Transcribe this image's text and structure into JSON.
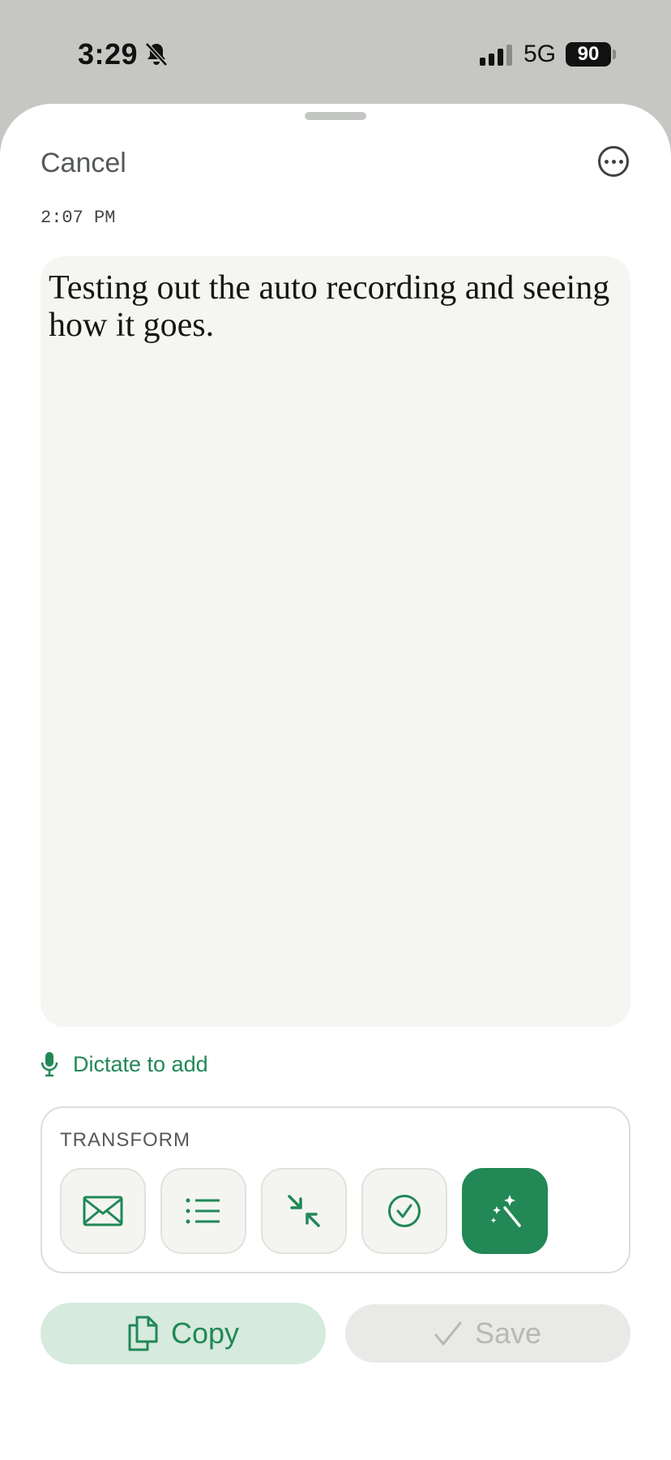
{
  "status_bar": {
    "time": "3:29",
    "network": "5G",
    "battery": "90"
  },
  "header": {
    "cancel_label": "Cancel",
    "more_icon": "ellipsis-circle-icon"
  },
  "note": {
    "timestamp": "2:07 PM",
    "text": "Testing out the auto recording and seeing how it goes."
  },
  "dictate": {
    "label": "Dictate to add",
    "icon": "microphone-icon"
  },
  "transform": {
    "title": "TRANSFORM",
    "tools": [
      {
        "icon": "mail-icon"
      },
      {
        "icon": "list-icon"
      },
      {
        "icon": "shrink-icon"
      },
      {
        "icon": "check-circle-icon"
      },
      {
        "icon": "magic-wand-icon",
        "active": true
      }
    ]
  },
  "actions": {
    "copy_label": "Copy",
    "save_label": "Save"
  },
  "colors": {
    "accent": "#218856",
    "accent_light": "#d6eadd",
    "note_bg": "#f5f6f2",
    "disabled": "#b7b9b6"
  }
}
